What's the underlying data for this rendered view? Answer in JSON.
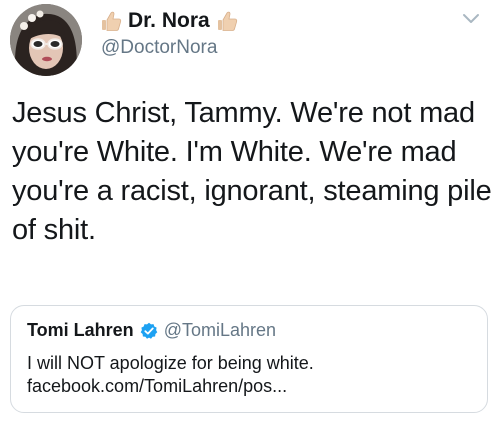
{
  "tweet": {
    "author": {
      "display_name": "Dr. Nora",
      "handle": "@DoctorNora",
      "name_emojis": [
        "thumbs-up-icon",
        "thumbs-up-icon"
      ]
    },
    "body_lines": [
      "Jesus Christ, Tammy. We're not mad",
      "you're White. I'm White. We're mad",
      "you're a racist, ignorant, steaming pile",
      "of shit."
    ],
    "menu_icon": "chevron-down-icon",
    "quoted": {
      "display_name": "Tomi Lahren",
      "handle": "@TomiLahren",
      "verified_icon": "verified-badge-icon",
      "lines": [
        "I will NOT apologize for being white.",
        "facebook.com/TomiLahren/pos..."
      ]
    }
  },
  "colors": {
    "text": "#14171a",
    "secondary_text": "#657786",
    "verified_blue": "#1da1f2",
    "card_border": "#d6dbe0"
  }
}
